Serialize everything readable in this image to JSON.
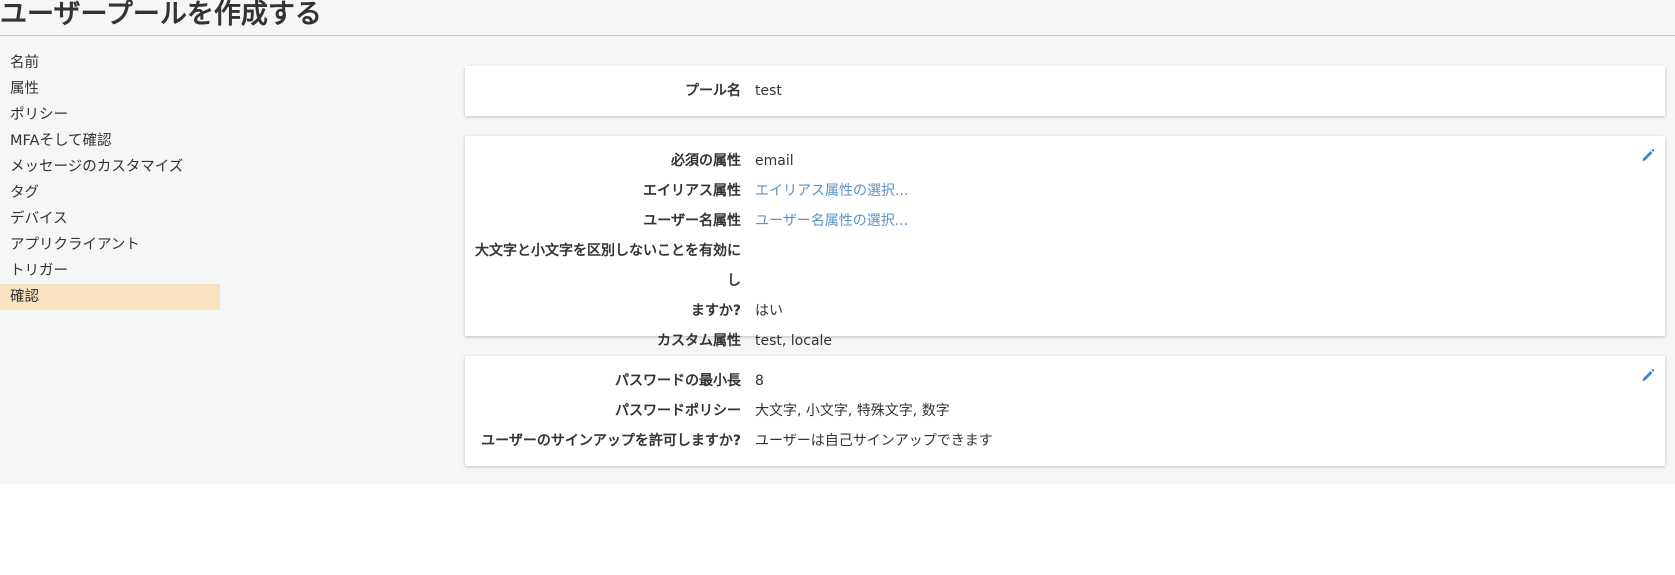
{
  "header": {
    "title": "ユーザープールを作成する"
  },
  "sidebar": {
    "items": [
      {
        "label": "名前"
      },
      {
        "label": "属性"
      },
      {
        "label": "ポリシー"
      },
      {
        "label": "MFAそして確認"
      },
      {
        "label": "メッセージのカスタマイズ"
      },
      {
        "label": "タグ"
      },
      {
        "label": "デバイス"
      },
      {
        "label": "アプリクライアント"
      },
      {
        "label": "トリガー"
      },
      {
        "label": "確認"
      }
    ],
    "active": "確認"
  },
  "pool_panel": {
    "pool_name_label": "プール名",
    "pool_name_value": "test"
  },
  "attributes_panel": {
    "required_label": "必須の属性",
    "required_value": "email",
    "alias_label": "エイリアス属性",
    "alias_link": "エイリアス属性の選択...",
    "username_label": "ユーザー名属性",
    "username_link": "ユーザー名属性の選択...",
    "case_label_line1": "大文字と小文字を区別しないことを有効にし",
    "case_label_line2": "ますか?",
    "case_value": "はい",
    "custom_label": "カスタム属性",
    "custom_value": "test, locale"
  },
  "password_panel": {
    "min_length_label": "パスワードの最小長",
    "min_length_value": "8",
    "policy_label": "パスワードポリシー",
    "policy_value": "大文字, 小文字, 特殊文字, 数字",
    "signup_label": "ユーザーのサインアップを許可しますか?",
    "signup_value": "ユーザーは自己サインアップできます"
  },
  "colors": {
    "accent_link": "#5b92c7",
    "active_nav": "#f8e2c2",
    "background": "#f5f6f6",
    "edit_icon": "#3f86c8"
  },
  "icons": {
    "edit": "pencil-icon"
  }
}
